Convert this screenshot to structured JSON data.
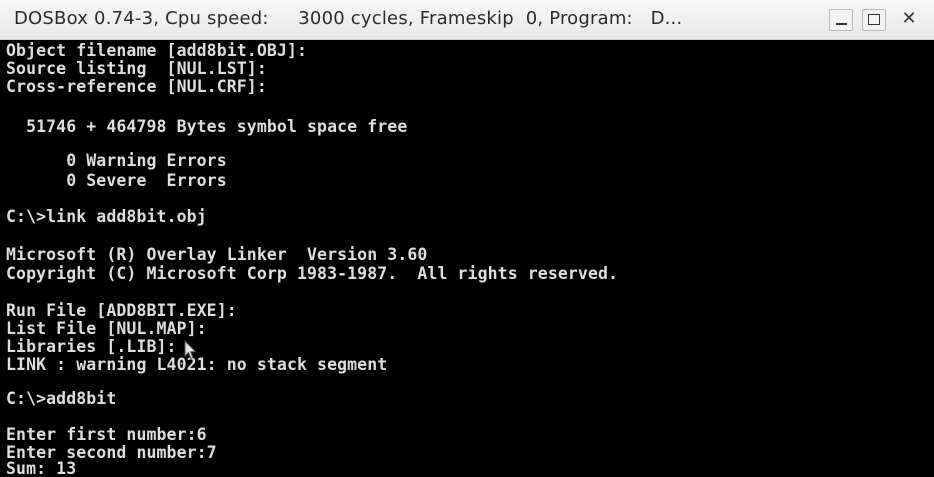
{
  "window": {
    "title": "DOSBox 0.74-3, Cpu speed:     3000 cycles, Frameskip  0, Program:   D...",
    "minimize_label": "_",
    "maximize_icon": "maximize-icon",
    "close_label": "✕"
  },
  "console": {
    "lines": [
      "Object filename [add8bit.OBJ]:",
      "Source listing  [NUL.LST]:",
      "Cross-reference [NUL.CRF]:",
      "  51746 + 464798 Bytes symbol space free",
      "      0 Warning Errors",
      "      0 Severe  Errors",
      "C:\\>link add8bit.obj",
      "Microsoft (R) Overlay Linker  Version 3.60",
      "Copyright (C) Microsoft Corp 1983-1987.  All rights reserved.",
      "Run File [ADD8BIT.EXE]:",
      "List File [NUL.MAP]:",
      "Libraries [.LIB]:",
      "LINK : warning L4021: no stack segment",
      "C:\\>add8bit",
      "Enter first number:6",
      "Enter second number:7",
      "Sum: 13"
    ]
  },
  "colors": {
    "terminal_bg": "#000000",
    "terminal_text": "#dedede",
    "titlebar_bg": "#f0f0f0"
  }
}
